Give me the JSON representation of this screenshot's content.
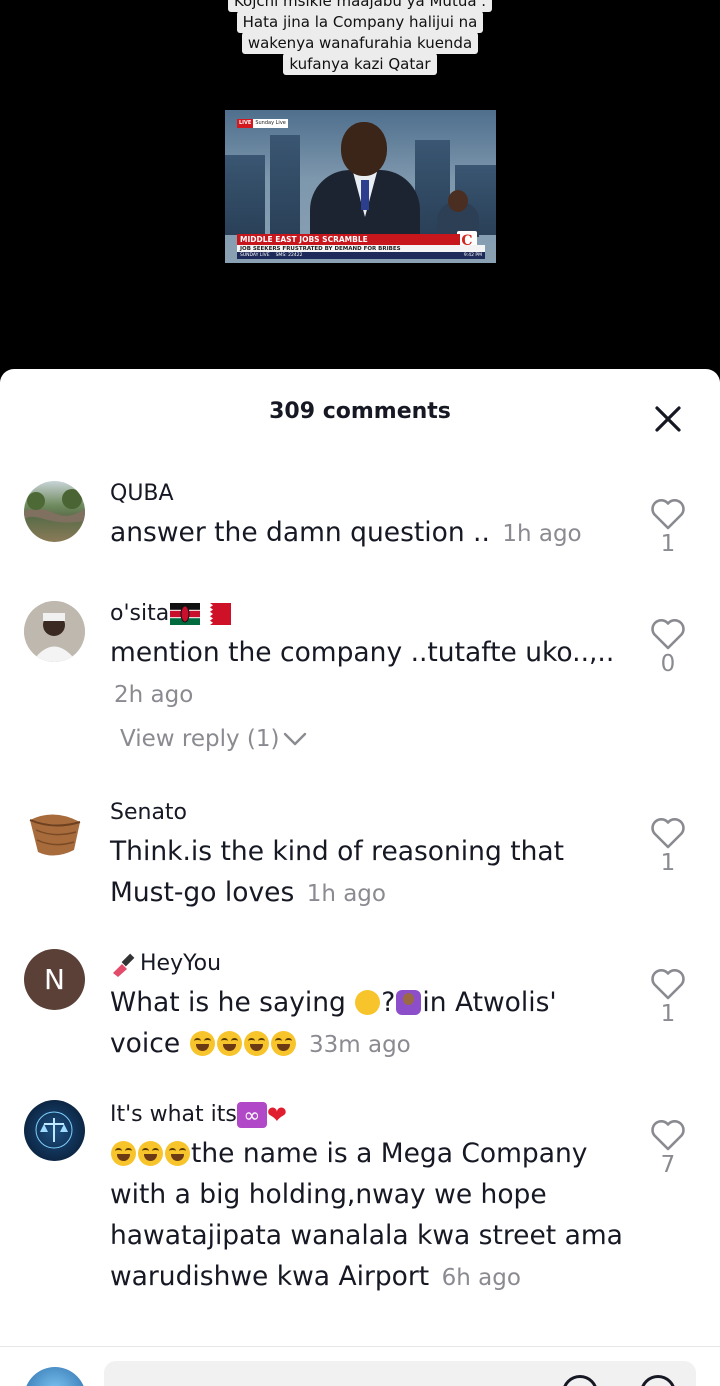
{
  "video": {
    "caption_lines": [
      "Kojchi msikie maajabu ya Mutua .",
      "Hata jina la Company halijui na",
      "wakenya wanafurahia kuenda",
      "kufanya kazi Qatar"
    ],
    "thumbnail": {
      "live_label": "LIVE",
      "show_label": "Sunday Live",
      "headline": "MIDDLE EAST JOBS SCRAMBLE",
      "subheadline": "JOB SEEKERS FRUSTRATED BY DEMAND FOR BRIBES",
      "ticker_show": "SUNDAY LIVE",
      "ticker_sms": "SMS: 22422",
      "ticker_time": "9:42 PM",
      "logo": "C"
    }
  },
  "sheet": {
    "title": "309 comments",
    "close_icon": "close-icon"
  },
  "comments": [
    {
      "username": "QUBA",
      "text": "answer the damn question ..",
      "time": "1h ago",
      "likes": "1"
    },
    {
      "username": "o'sita",
      "text": "mention the company ..tutafte uko..,..",
      "time": "2h ago",
      "likes": "0",
      "view_reply": "View reply (1)"
    },
    {
      "username": "Senato",
      "text": "Think.is the kind of reasoning that Must-go loves",
      "time": "1h ago",
      "likes": "1"
    },
    {
      "username": "HeyYou",
      "avatar_letter": "N",
      "text_a": "What is he saying ",
      "text_b": "?",
      "text_c": "in Atwolis' voice ",
      "time": "33m ago",
      "likes": "1"
    },
    {
      "username": "It's what its",
      "text": "the name is a Mega Company with a big holding,nway we hope hawatajipata wanalala kwa street ama warudishwe kwa Airport",
      "time": "6h ago",
      "likes": "7"
    }
  ],
  "colors": {
    "accent_text": "#161823",
    "muted_text": "#8a8b91",
    "avatar_n_bg": "#5b4038"
  }
}
